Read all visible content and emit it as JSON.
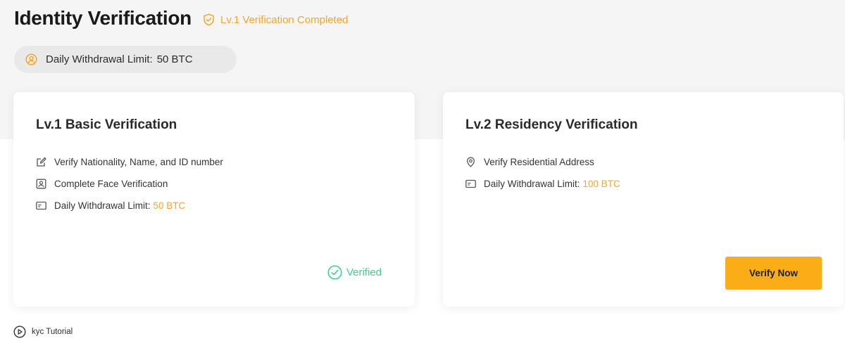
{
  "header": {
    "title": "Identity Verification",
    "status_text": "Lv.1 Verification Completed",
    "status_icon": "shield-check-icon"
  },
  "limit_pill": {
    "label": "Daily Withdrawal Limit:",
    "value": "50 BTC",
    "icon": "user-circle-icon"
  },
  "cards": [
    {
      "title": "Lv.1 Basic Verification",
      "features": [
        {
          "icon": "edit-icon",
          "text": "Verify Nationality, Name, and ID number",
          "highlight": ""
        },
        {
          "icon": "face-id-icon",
          "text": "Complete Face Verification",
          "highlight": ""
        },
        {
          "icon": "card-icon",
          "text": "Daily Withdrawal Limit:",
          "highlight": "50 BTC"
        }
      ],
      "status_label": "Verified"
    },
    {
      "title": "Lv.2 Residency Verification",
      "features": [
        {
          "icon": "location-pin-icon",
          "text": "Verify Residential Address",
          "highlight": ""
        },
        {
          "icon": "card-icon",
          "text": "Daily Withdrawal Limit:",
          "highlight": "100 BTC"
        }
      ],
      "button_label": "Verify Now"
    }
  ],
  "tutorial": {
    "label": "kyc Tutorial",
    "icon": "play-circle-icon"
  },
  "colors": {
    "accent": "#f5a623",
    "button": "#fbad18",
    "success": "#3fcf8e",
    "band": "#f5f5f5"
  }
}
